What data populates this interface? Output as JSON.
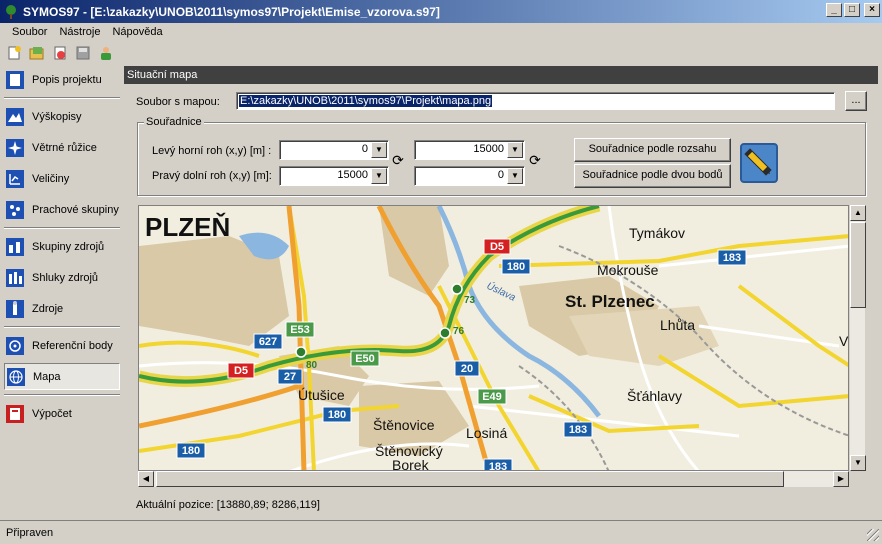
{
  "window": {
    "title": "SYMOS97 - [E:\\zakazky\\UNOB\\2011\\symos97\\Projekt\\Emise_vzorova.s97]"
  },
  "menu": [
    "Soubor",
    "Nástroje",
    "Nápověda"
  ],
  "toolbar": {
    "icons": [
      "new-project-icon",
      "open-project-icon",
      "recent-project-icon",
      "save-icon",
      "user-icon"
    ]
  },
  "sidebar": {
    "items": [
      {
        "label": "Popis projektu",
        "icon": "document-icon"
      },
      {
        "label": "Výškopisy",
        "icon": "terrain-icon"
      },
      {
        "label": "Větrné růžice",
        "icon": "wind-rose-icon"
      },
      {
        "label": "Veličiny",
        "icon": "quantities-icon"
      },
      {
        "label": "Prachové skupiny",
        "icon": "dust-icon"
      },
      {
        "label": "Skupiny zdrojů",
        "icon": "source-groups-icon"
      },
      {
        "label": "Shluky zdrojů",
        "icon": "source-clusters-icon"
      },
      {
        "label": "Zdroje",
        "icon": "sources-icon"
      },
      {
        "label": "Referenční body",
        "icon": "reference-points-icon"
      },
      {
        "label": "Mapa",
        "icon": "globe-icon"
      },
      {
        "label": "Výpočet",
        "icon": "calculation-icon"
      }
    ],
    "active": "Mapa"
  },
  "panel": {
    "header": "Situační mapa",
    "file_label": "Soubor s mapou:",
    "file_value": "E:\\zakazky\\UNOB\\2011\\symos97\\Projekt\\mapa.png",
    "browse_label": "...",
    "group_title": "Souřadnice",
    "top_left_label": "Levý horní roh (x,y) [m] :",
    "bottom_right_label": "Pravý dolní roh (x,y) [m]:",
    "top_left_x": "0",
    "top_left_y": "15000",
    "bottom_right_x": "15000",
    "bottom_right_y": "0",
    "btn_extent": "Souřadnice podle rozsahu",
    "btn_two_points": "Souřadnice podle dvou bodů",
    "position_text": "Aktuální pozice: [13880,89; 8286,119]"
  },
  "map": {
    "places": [
      "PLZEŇ",
      "Tymákov",
      "Mokrouše",
      "St. Plzenec",
      "Lhůta",
      "Šťáhlavy",
      "Útušice",
      "Štěnovice",
      "Losiná",
      "Štěnovický",
      "Borek",
      "V",
      "Úslava"
    ],
    "road_shields": [
      {
        "text": "D5",
        "color": "#d42020"
      },
      {
        "text": "180",
        "color": "#1a5ea8"
      },
      {
        "text": "183",
        "color": "#1a5ea8"
      },
      {
        "text": "627",
        "color": "#1a5ea8"
      },
      {
        "text": "E53",
        "color": "#4a9a4a"
      },
      {
        "text": "E50",
        "color": "#4a9a4a"
      },
      {
        "text": "E49",
        "color": "#4a9a4a"
      },
      {
        "text": "27",
        "color": "#1a5ea8"
      },
      {
        "text": "20",
        "color": "#1a5ea8"
      }
    ],
    "exits": [
      "73",
      "76",
      "80"
    ]
  },
  "status": {
    "text": "Připraven"
  }
}
